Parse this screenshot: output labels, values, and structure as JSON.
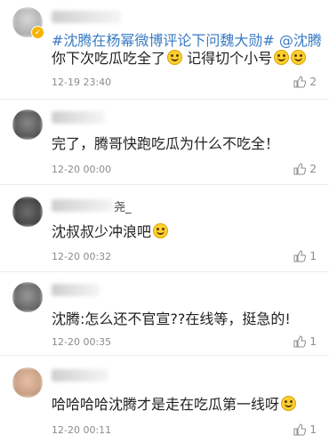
{
  "comments": [
    {
      "id": "c1",
      "text_prefix_link": "#沈腾在杨幂微博评论下问魏大勋# @沈腾",
      "text": "你下次吃瓜吃全了",
      "text_suffix": " 记得切个小号",
      "time": "12-19 23:40",
      "likes": "2"
    },
    {
      "id": "c2",
      "text": "完了，腾哥快跑吃瓜为什么不吃全！",
      "time": "12-20 00:00",
      "likes": "2"
    },
    {
      "id": "c3",
      "username_tail": "尧_",
      "text": "沈叔叔少冲浪吧",
      "time": "12-20 00:32",
      "likes": "1"
    },
    {
      "id": "c4",
      "text": "沈腾:怎么还不官宣??在线等，挺急的!",
      "time": "12-20 00:35",
      "likes": "1"
    },
    {
      "id": "c5",
      "text": "哈哈哈哈沈腾才是走在吃瓜第一线呀",
      "time": "12-20 00:11",
      "likes": "1"
    }
  ],
  "icons": {
    "like": "thumbs-up-icon",
    "verified": "verified-badge-icon"
  },
  "colors": {
    "link": "#3b7cc4",
    "meta": "#8c8c8c",
    "badge": "#f5b400"
  }
}
